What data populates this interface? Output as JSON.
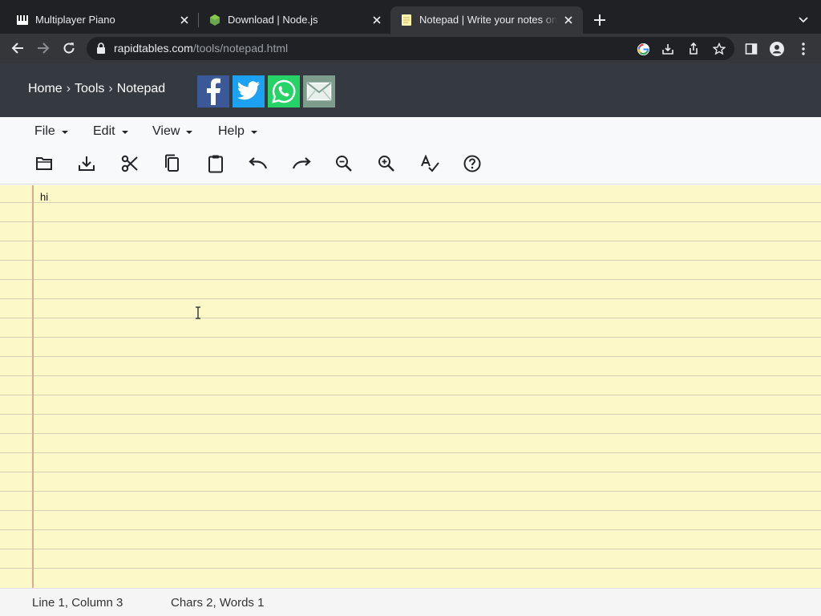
{
  "browser": {
    "tabs": [
      {
        "title": "Multiplayer Piano",
        "icon": "piano-icon"
      },
      {
        "title": "Download | Node.js",
        "icon": "nodejs-icon"
      },
      {
        "title": "Notepad | Write your notes online",
        "icon": "notepad-icon",
        "active": true
      }
    ],
    "url_host": "rapidtables.com",
    "url_path": "/tools/notepad.html"
  },
  "site": {
    "breadcrumb": {
      "home": "Home",
      "tools": "Tools",
      "current": "Notepad",
      "separator": "›"
    },
    "share": [
      "facebook",
      "twitter",
      "whatsapp",
      "email"
    ],
    "share_colors": {
      "facebook": "#3b5998",
      "twitter": "#1da1f2",
      "whatsapp": "#25d366",
      "email": "#7e9c8c"
    }
  },
  "menu": {
    "file": "File",
    "edit": "Edit",
    "view": "View",
    "help": "Help"
  },
  "tools": [
    "open-icon",
    "download-icon",
    "cut-icon",
    "copy-icon",
    "paste-icon",
    "undo-icon",
    "redo-icon",
    "zoom-out-icon",
    "zoom-in-icon",
    "spellcheck-icon",
    "help-icon"
  ],
  "editor": {
    "content": "hi",
    "paper_color": "#fdf8c8",
    "margin_color": "#e0a896"
  },
  "status": {
    "position": "Line 1, Column 3",
    "counts": "Chars 2, Words 1"
  }
}
